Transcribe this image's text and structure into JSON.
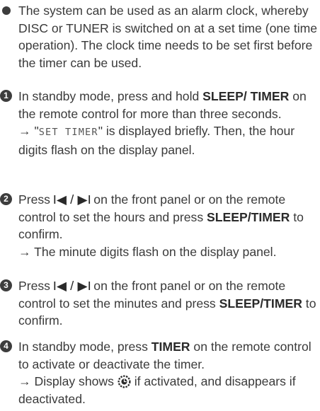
{
  "intro": {
    "text": "The system can be used as an alarm clock, whereby DISC or TUNER is switched on at a set time (one time operation). The clock time needs to be set first before the timer can be used."
  },
  "steps": [
    {
      "num": "1",
      "t1": "In standby mode, press and hold ",
      "b1": "SLEEP/ TIMER",
      "t2": " on the remote control for more than three seconds.",
      "r_arrow": "→",
      "r_q1": " \"",
      "r_lcd": "SET TIMER",
      "r_q2": "\"",
      "r_text": " is displayed briefly. Then, the hour digits flash on the display panel."
    },
    {
      "num": "2",
      "t1": "Press ",
      "sym": "I◀ / ▶I",
      "t2": " on the front panel or on the remote control to set the hours and press ",
      "b1": "SLEEP/TIMER",
      "t3": " to confirm.",
      "r_arrow": "→",
      "r_text": " The minute digits flash on the display panel."
    },
    {
      "num": "3",
      "t1": "Press ",
      "sym": "I◀ / ▶I",
      "t2": " on the front panel or on the remote control to set the minutes and press ",
      "b1": "SLEEP/TIMER",
      "t3": " to confirm."
    },
    {
      "num": "4",
      "t1": "In standby mode, press ",
      "b1": "TIMER",
      "t2": " on the remote control to activate or deactivate the timer.",
      "r_arrow": "→",
      "r_t1": " Display shows ",
      "r_icon": "timer-icon",
      "r_t2": " if activated, and disappears if deactivated."
    }
  ]
}
